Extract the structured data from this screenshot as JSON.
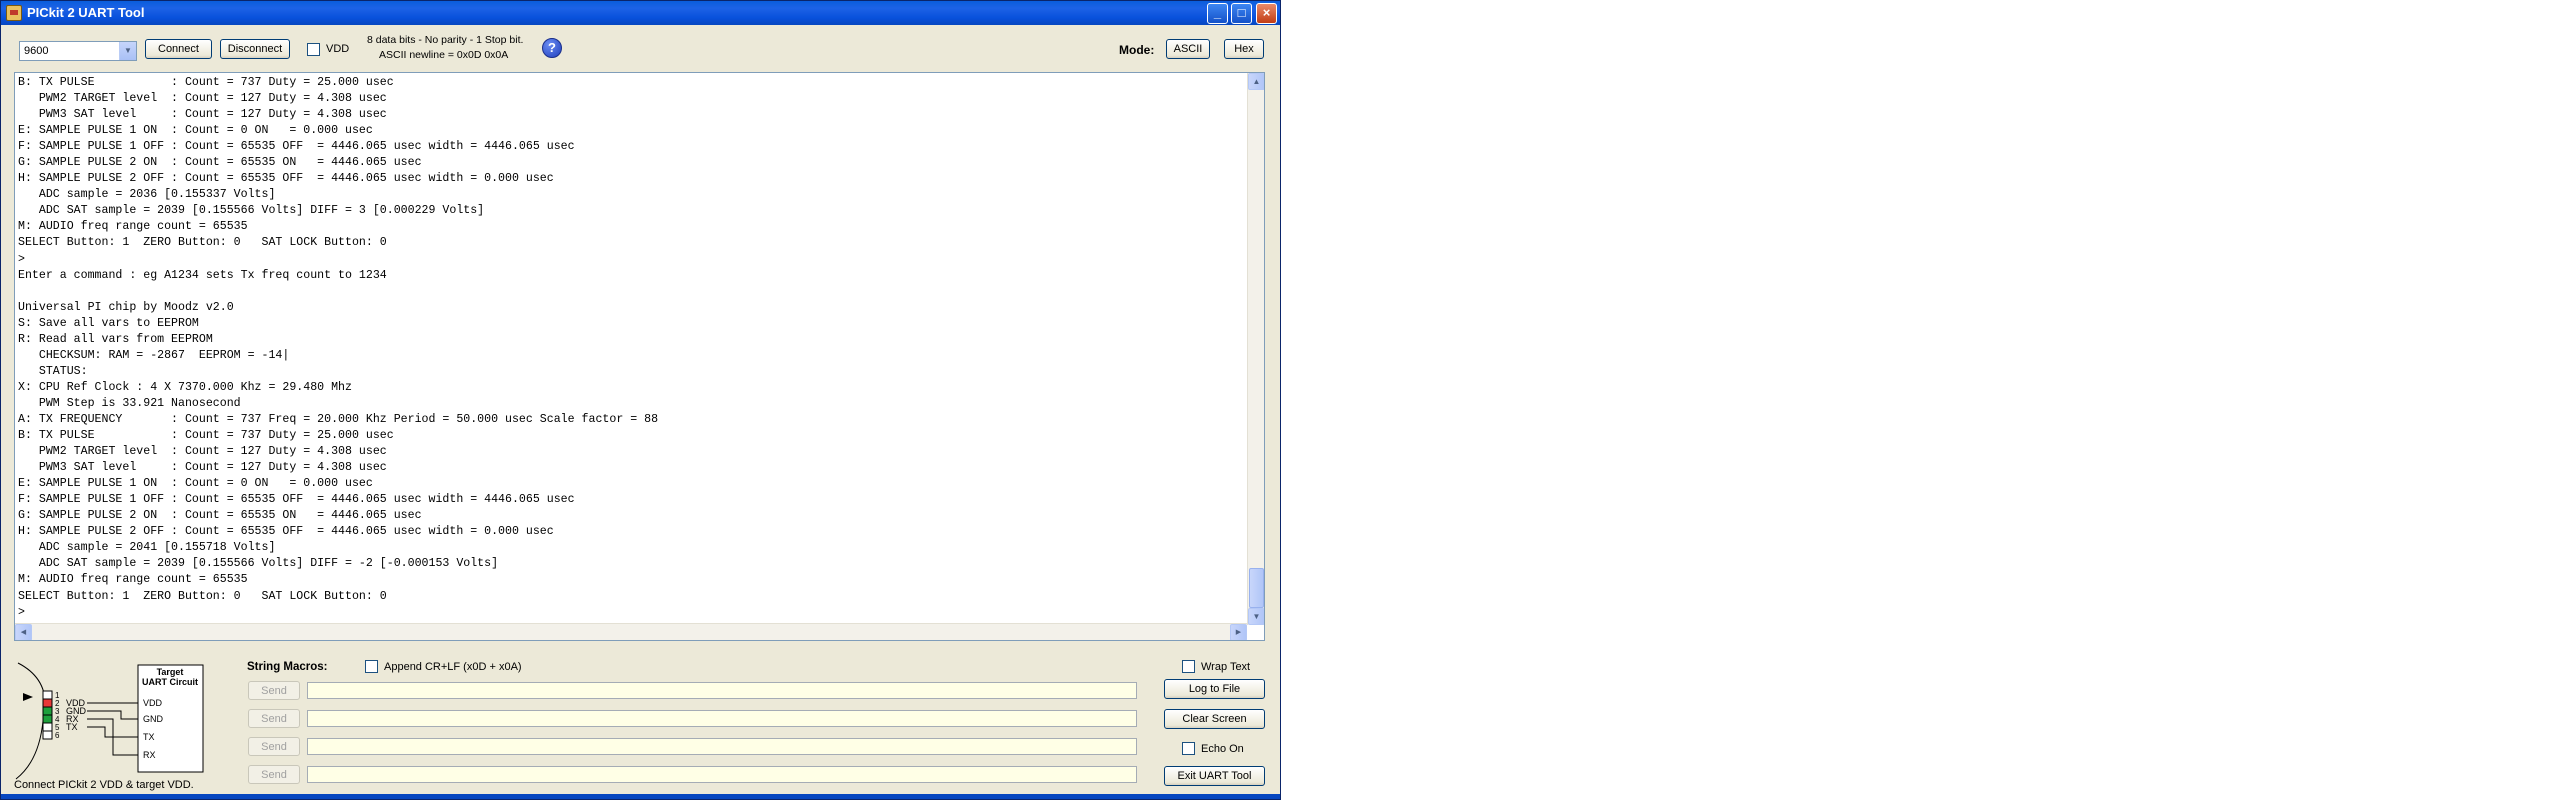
{
  "window": {
    "title": "PICkit 2 UART Tool"
  },
  "toolbar": {
    "baud_value": "9600",
    "connect_label": "Connect",
    "disconnect_label": "Disconnect",
    "vdd_label": "VDD",
    "serial_info_line1": "8 data bits - No parity - 1 Stop bit.",
    "serial_info_line2": "ASCII newline = 0x0D 0x0A",
    "help_glyph": "?",
    "mode_label": "Mode:",
    "ascii_label": "ASCII",
    "hex_label": "Hex"
  },
  "console": {
    "lines": [
      "B: TX PULSE           : Count = 737 Duty = 25.000 usec",
      "   PWM2 TARGET level  : Count = 127 Duty = 4.308 usec",
      "   PWM3 SAT level     : Count = 127 Duty = 4.308 usec",
      "E: SAMPLE PULSE 1 ON  : Count = 0 ON   = 0.000 usec",
      "F: SAMPLE PULSE 1 OFF : Count = 65535 OFF  = 4446.065 usec width = 4446.065 usec",
      "G: SAMPLE PULSE 2 ON  : Count = 65535 ON   = 4446.065 usec",
      "H: SAMPLE PULSE 2 OFF : Count = 65535 OFF  = 4446.065 usec width = 0.000 usec",
      "   ADC sample = 2036 [0.155337 Volts]",
      "   ADC SAT sample = 2039 [0.155566 Volts] DIFF = 3 [0.000229 Volts]",
      "M: AUDIO freq range count = 65535",
      "SELECT Button: 1  ZERO Button: 0   SAT LOCK Button: 0",
      ">",
      "Enter a command : eg A1234 sets Tx freq count to 1234",
      "",
      "Universal PI chip by Moodz v2.0",
      "S: Save all vars to EEPROM",
      "R: Read all vars from EEPROM",
      "   CHECKSUM: RAM = -2867  EEPROM = -14|",
      "   STATUS:",
      "X: CPU Ref Clock : 4 X 7370.000 Khz = 29.480 Mhz",
      "   PWM Step is 33.921 Nanosecond",
      "A: TX FREQUENCY       : Count = 737 Freq = 20.000 Khz Period = 50.000 usec Scale factor = 88",
      "B: TX PULSE           : Count = 737 Duty = 25.000 usec",
      "   PWM2 TARGET level  : Count = 127 Duty = 4.308 usec",
      "   PWM3 SAT level     : Count = 127 Duty = 4.308 usec",
      "E: SAMPLE PULSE 1 ON  : Count = 0 ON   = 0.000 usec",
      "F: SAMPLE PULSE 1 OFF : Count = 65535 OFF  = 4446.065 usec width = 4446.065 usec",
      "G: SAMPLE PULSE 2 ON  : Count = 65535 ON   = 4446.065 usec",
      "H: SAMPLE PULSE 2 OFF : Count = 65535 OFF  = 4446.065 usec width = 0.000 usec",
      "   ADC sample = 2041 [0.155718 Volts]",
      "   ADC SAT sample = 2039 [0.155566 Volts] DIFF = -2 [-0.000153 Volts]",
      "M: AUDIO freq range count = 65535",
      "SELECT Button: 1  ZERO Button: 0   SAT LOCK Button: 0",
      ">"
    ]
  },
  "macros": {
    "title": "String Macros:",
    "append_label": "Append CR+LF (x0D + x0A)",
    "send_label": "Send"
  },
  "side": {
    "wrap_label": "Wrap Text",
    "log_label": "Log to File",
    "clear_label": "Clear Screen",
    "echo_label": "Echo On",
    "exit_label": "Exit UART Tool"
  },
  "diagram": {
    "target_title_1": "Target",
    "target_title_2": "UART Circuit",
    "pins": [
      "1",
      "2",
      "3",
      "4",
      "5",
      "6"
    ],
    "pin_labels": [
      "VDD",
      "GND",
      "RX",
      "TX"
    ],
    "target_pins": [
      "VDD",
      "GND",
      "TX",
      "RX"
    ]
  },
  "footer": {
    "text": "Connect PICkit 2 VDD & target VDD."
  },
  "colors": {
    "titlebar": "#0a5ddc",
    "window_bg": "#ece9d8",
    "macro_field_bg": "#ffffe6"
  }
}
